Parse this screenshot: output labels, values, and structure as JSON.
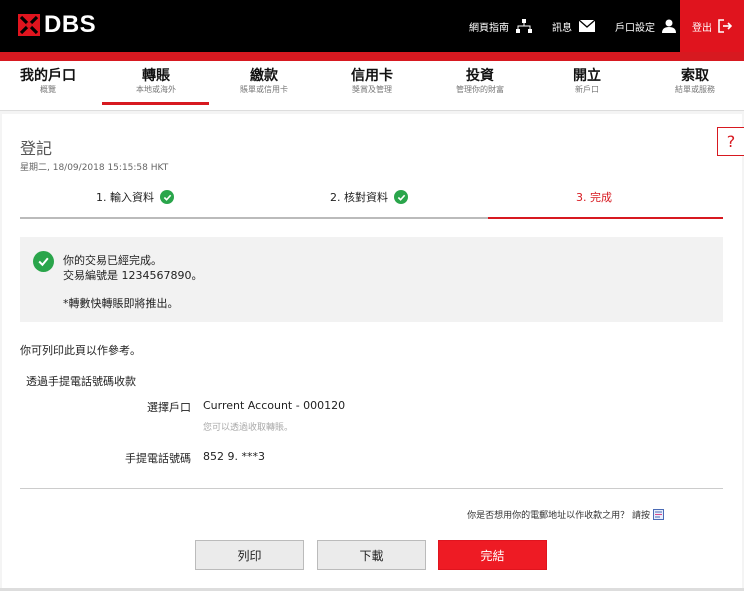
{
  "brand": {
    "logo_text": "DBS",
    "accent": "#d71920",
    "success": "#2aa54b"
  },
  "topbar": {
    "links": [
      {
        "label": "網頁指南",
        "icon": "sitemap-icon"
      },
      {
        "label": "訊息",
        "icon": "mail-icon"
      },
      {
        "label": "戶口設定",
        "icon": "user-icon"
      }
    ],
    "logout_label": "登出"
  },
  "nav": {
    "items": [
      {
        "label": "我的戶口",
        "sub": "概覽"
      },
      {
        "label": "轉賬",
        "sub": "本地或海外"
      },
      {
        "label": "繳款",
        "sub": "賬單或信用卡"
      },
      {
        "label": "信用卡",
        "sub": "獎賞及管理"
      },
      {
        "label": "投資",
        "sub": "管理你的財富"
      },
      {
        "label": "開立",
        "sub": "新戶口"
      },
      {
        "label": "索取",
        "sub": "結單或服務"
      }
    ],
    "active_index": 1
  },
  "page": {
    "title": "登記",
    "datetime": "星期二, 18/09/2018 15:15:58 HKT",
    "help_label": "?"
  },
  "steps": [
    {
      "label": "1. 輸入資料",
      "done": true
    },
    {
      "label": "2. 核對資料",
      "done": true
    },
    {
      "label": "3. 完成",
      "done": false,
      "current": true
    }
  ],
  "success": {
    "line1": "你的交易已經完成。",
    "line2": "交易編號是 1234567890。",
    "line3": "*轉數快轉賬即將推出。"
  },
  "print_note": "你可列印此頁以作參考。",
  "section_title": "透過手提電話號碼收款",
  "fields": {
    "account_label": "選擇戶口",
    "account_value": "Current Account - 000120",
    "account_hint": "您可以透過收取轉賬。",
    "phone_label": "手提電話號碼",
    "phone_value": "852 9.       ***3"
  },
  "email_question": "你是否想用你的電郵地址以作收款之用？ 請按",
  "buttons": {
    "print": "列印",
    "download": "下載",
    "finish": "完結"
  }
}
